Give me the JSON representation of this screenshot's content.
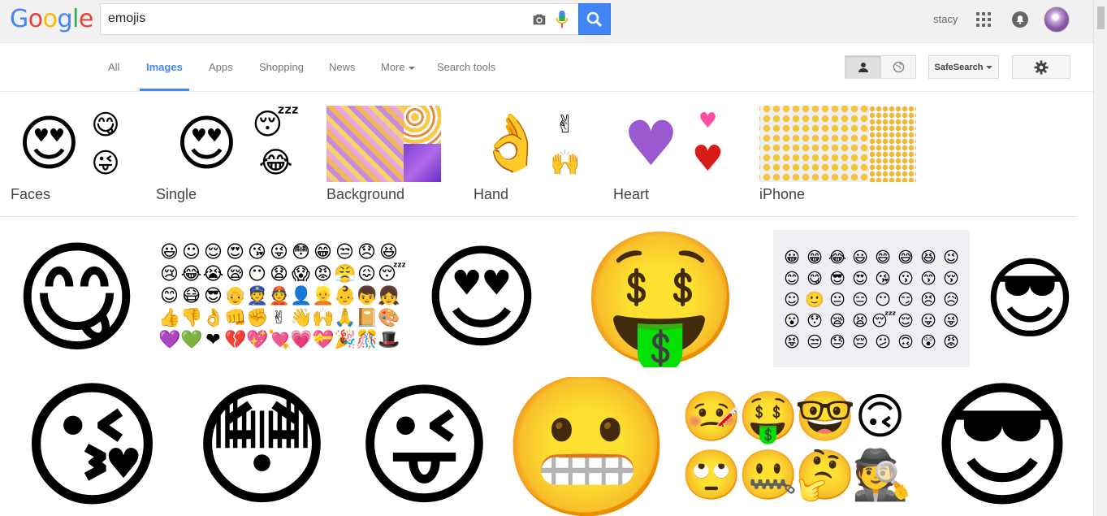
{
  "header": {
    "logo_letters": [
      {
        "ch": "G",
        "color": "#4285f4"
      },
      {
        "ch": "o",
        "color": "#ea4335"
      },
      {
        "ch": "o",
        "color": "#fbbc05"
      },
      {
        "ch": "g",
        "color": "#4285f4"
      },
      {
        "ch": "l",
        "color": "#34a853"
      },
      {
        "ch": "e",
        "color": "#ea4335"
      }
    ],
    "search_query": "emojis",
    "user_name": "stacy"
  },
  "nav": {
    "tabs": [
      "All",
      "Images",
      "Apps",
      "Shopping",
      "News",
      "More",
      "Search tools"
    ],
    "active_tab": "Images",
    "safesearch_label": "SafeSearch"
  },
  "related": [
    {
      "label": "Faces"
    },
    {
      "label": "Single"
    },
    {
      "label": "Background"
    },
    {
      "label": "Hand"
    },
    {
      "label": "Heart"
    },
    {
      "label": "iPhone"
    }
  ],
  "colors": {
    "accent": "#4285f4",
    "emoji_yellow": "#fbc02d"
  }
}
